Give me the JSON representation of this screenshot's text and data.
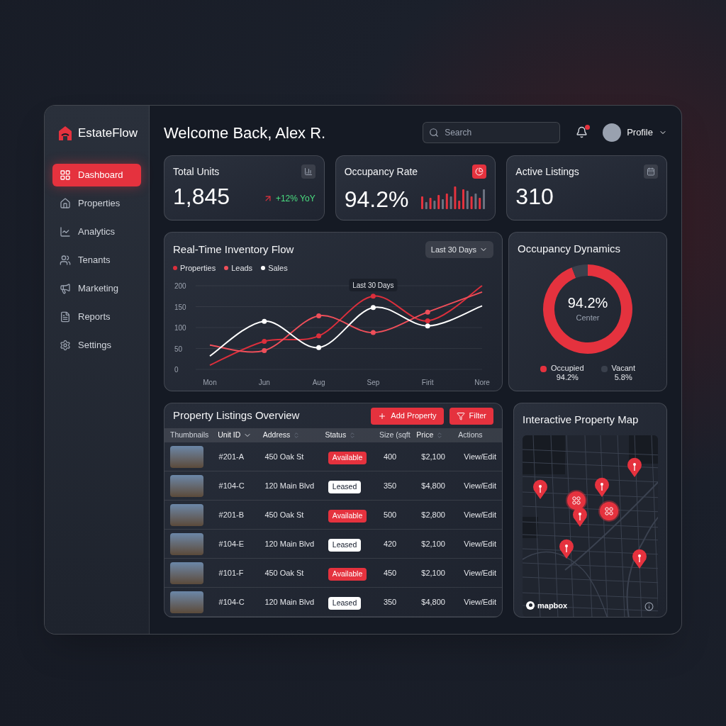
{
  "app": {
    "name": "EstateFlow"
  },
  "sidebar": {
    "items": [
      {
        "label": "Dashboard",
        "selected": true
      },
      {
        "label": "Properties",
        "selected": false
      },
      {
        "label": "Analytics",
        "selected": false
      },
      {
        "label": "Tenants",
        "selected": false
      },
      {
        "label": "Marketing",
        "selected": false
      },
      {
        "label": "Reports",
        "selected": false
      },
      {
        "label": "Settings",
        "selected": false
      }
    ]
  },
  "header": {
    "greeting": "Welcome Back, Alex R.",
    "search": {
      "placeholder": "Search"
    },
    "notifications": {
      "unread": true
    },
    "profile": {
      "label": "Profile"
    }
  },
  "kpis": [
    {
      "kind": "trend",
      "title": "Total Units",
      "value": "1,845",
      "trend": "+12% YoY"
    },
    {
      "kind": "sparkline",
      "title": "Occupancy Rate",
      "value": "94.2%"
    },
    {
      "kind": "plain",
      "title": "Active Listings",
      "value": "310"
    }
  ],
  "inventory": {
    "title": "Real-Time Inventory Flow",
    "range": "Last 30 Days",
    "chart_data": {
      "type": "line",
      "categories": [
        "Mon",
        "Jun",
        "Aug",
        "Sep",
        "Firit",
        "Nore"
      ],
      "ylim": [
        0,
        200
      ],
      "yticks": [
        0,
        50,
        100,
        150,
        200
      ],
      "series": [
        {
          "name": "Properties",
          "color": "#dc2f3c",
          "values": [
            10,
            67,
            80,
            175,
            116,
            200
          ]
        },
        {
          "name": "Leads",
          "color": "#ef4f5a",
          "values": [
            58,
            45,
            128,
            88,
            137,
            185
          ]
        },
        {
          "name": "Sales",
          "color": "#ffffff",
          "values": [
            32,
            115,
            52,
            148,
            104,
            152
          ]
        }
      ],
      "grid": true,
      "annotations": [
        "Last 30 Days"
      ]
    }
  },
  "occupancy": {
    "title": "Occupancy Dynamics",
    "center_value": "94.2%",
    "center_label": "Center",
    "chart_data": {
      "type": "donut",
      "categories": [
        "Occupied",
        "Vacant"
      ],
      "values": [
        94.2,
        5.8
      ]
    },
    "legend": [
      {
        "value": "94.2%",
        "color": "#e5323e"
      },
      {
        "value": "5.8%",
        "color": "#3a404c"
      }
    ]
  },
  "listings": {
    "title": "Property Listings Overview",
    "actions": [
      {
        "kind": "add",
        "label": "Add Property"
      },
      {
        "kind": "filter",
        "label": "Filter"
      }
    ],
    "columns": [
      {
        "label": "Thumbnails",
        "sortable": false,
        "sorted": false
      },
      {
        "label": "Unit ID",
        "sortable": true,
        "sorted": true
      },
      {
        "label": "Address",
        "sortable": true,
        "sorted": false
      },
      {
        "label": "Status",
        "sortable": true,
        "sorted": false
      },
      {
        "label": "Size (sqft",
        "sortable": false,
        "sorted": false
      },
      {
        "label": "Price",
        "sortable": true,
        "sorted": false
      },
      {
        "label": "Actions",
        "sortable": false,
        "sorted": false
      }
    ],
    "rows": [
      {
        "unit": "#201-A",
        "address": "450 Oak St",
        "status": {
          "kind": "available",
          "label": "Available"
        },
        "size": "400",
        "price": "$2,100",
        "action": "View/Edit"
      },
      {
        "unit": "#104-C",
        "address": "120 Main Blvd",
        "status": {
          "kind": "leased",
          "label": "Leased"
        },
        "size": "350",
        "price": "$4,800",
        "action": "View/Edit"
      },
      {
        "unit": "#201-B",
        "address": "450 Oak St",
        "status": {
          "kind": "available",
          "label": "Available"
        },
        "size": "500",
        "price": "$2,800",
        "action": "View/Edit"
      },
      {
        "unit": "#104-E",
        "address": "120 Main Blvd",
        "status": {
          "kind": "leased",
          "label": "Leased"
        },
        "size": "420",
        "price": "$2,100",
        "action": "View/Edit"
      },
      {
        "unit": "#101-F",
        "address": "450 Oak St",
        "status": {
          "kind": "available",
          "label": "Available"
        },
        "size": "450",
        "price": "$2,100",
        "action": "View/Edit"
      },
      {
        "unit": "#104-C",
        "address": "120 Main Blvd",
        "status": {
          "kind": "leased",
          "label": "Leased"
        },
        "size": "350",
        "price": "$4,800",
        "action": "View/Edit"
      }
    ]
  },
  "map": {
    "title": "Interactive Property Map",
    "attribution": "mapbox"
  }
}
